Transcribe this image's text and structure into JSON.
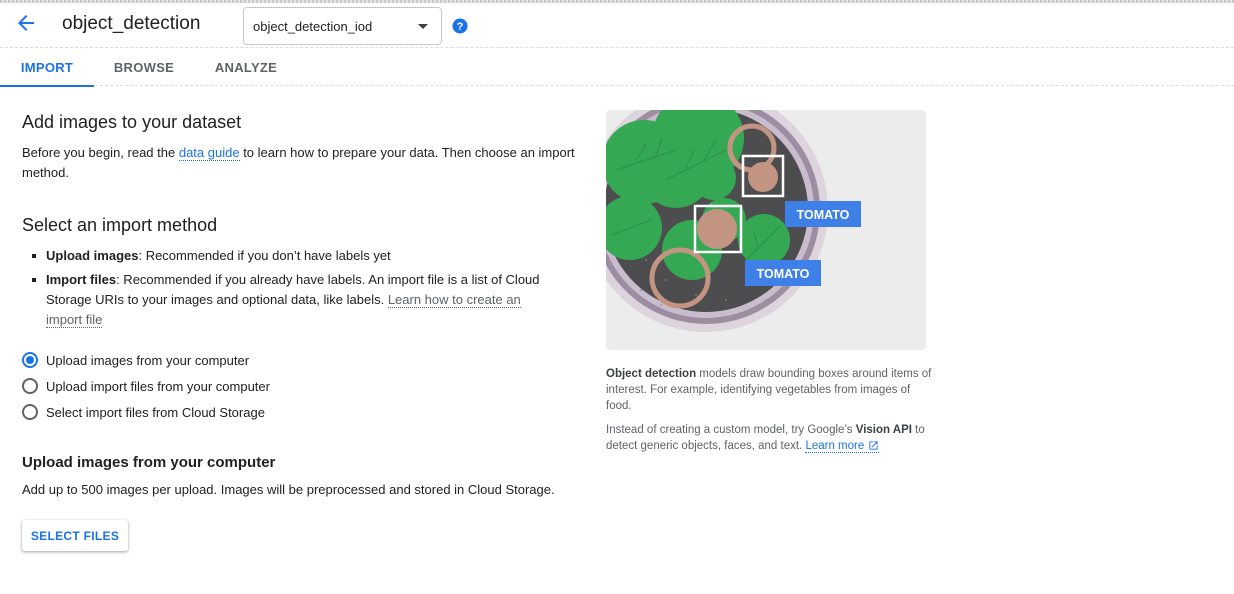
{
  "header": {
    "title": "object_detection",
    "model_select_value": "object_detection_iod",
    "icons": {
      "back": "arrow-back-icon",
      "help": "help-circle-icon",
      "dropdown": "caret-down-icon"
    }
  },
  "tabs": [
    {
      "label": "IMPORT",
      "active": true
    },
    {
      "label": "BROWSE",
      "active": false
    },
    {
      "label": "ANALYZE",
      "active": false
    }
  ],
  "intro": {
    "heading": "Add images to your dataset",
    "text_before_link": "Before you begin, read the ",
    "link_text": "data guide",
    "text_after_link": " to learn how to prepare your data. Then choose an import method."
  },
  "import_method": {
    "heading": "Select an import method",
    "bullets": [
      {
        "bold": "Upload images",
        "text": ": Recommended if you don’t have labels yet",
        "link": ""
      },
      {
        "bold": "Import files",
        "text": ": Recommended if you already have labels. An import file is a list of Cloud Storage URIs to your images and optional data, like labels. ",
        "link": "Learn how to create an import file"
      }
    ],
    "options": [
      {
        "label": "Upload images from your computer",
        "checked": true
      },
      {
        "label": "Upload import files from your computer",
        "checked": false
      },
      {
        "label": "Select import files from Cloud Storage",
        "checked": false
      }
    ]
  },
  "upload": {
    "heading": "Upload images from your computer",
    "description": "Add up to 500 images per upload. Images will be preprocessed and stored in Cloud Storage.",
    "button_label": "SELECT FILES"
  },
  "illustration": {
    "labels": [
      "TOMATO",
      "TOMATO"
    ]
  },
  "side_info": {
    "p1_bold": "Object detection",
    "p1_text": " models draw bounding boxes around items of interest. For example, identifying vegetables from images of food.",
    "p2_text_before": "Instead of creating a custom model, try Google’s ",
    "p2_bold": "Vision API",
    "p2_text_after": " to detect generic objects, faces, and text. ",
    "p2_link": "Learn more",
    "link_icon": "open-in-new-icon"
  },
  "colors": {
    "accent": "#1a73e8",
    "text": "#202124",
    "muted": "#5f6368",
    "label_bg": "#3f80e8",
    "leaf_green": "#34a853",
    "tomato": "#c49483",
    "bowl": "#4d4d50"
  }
}
